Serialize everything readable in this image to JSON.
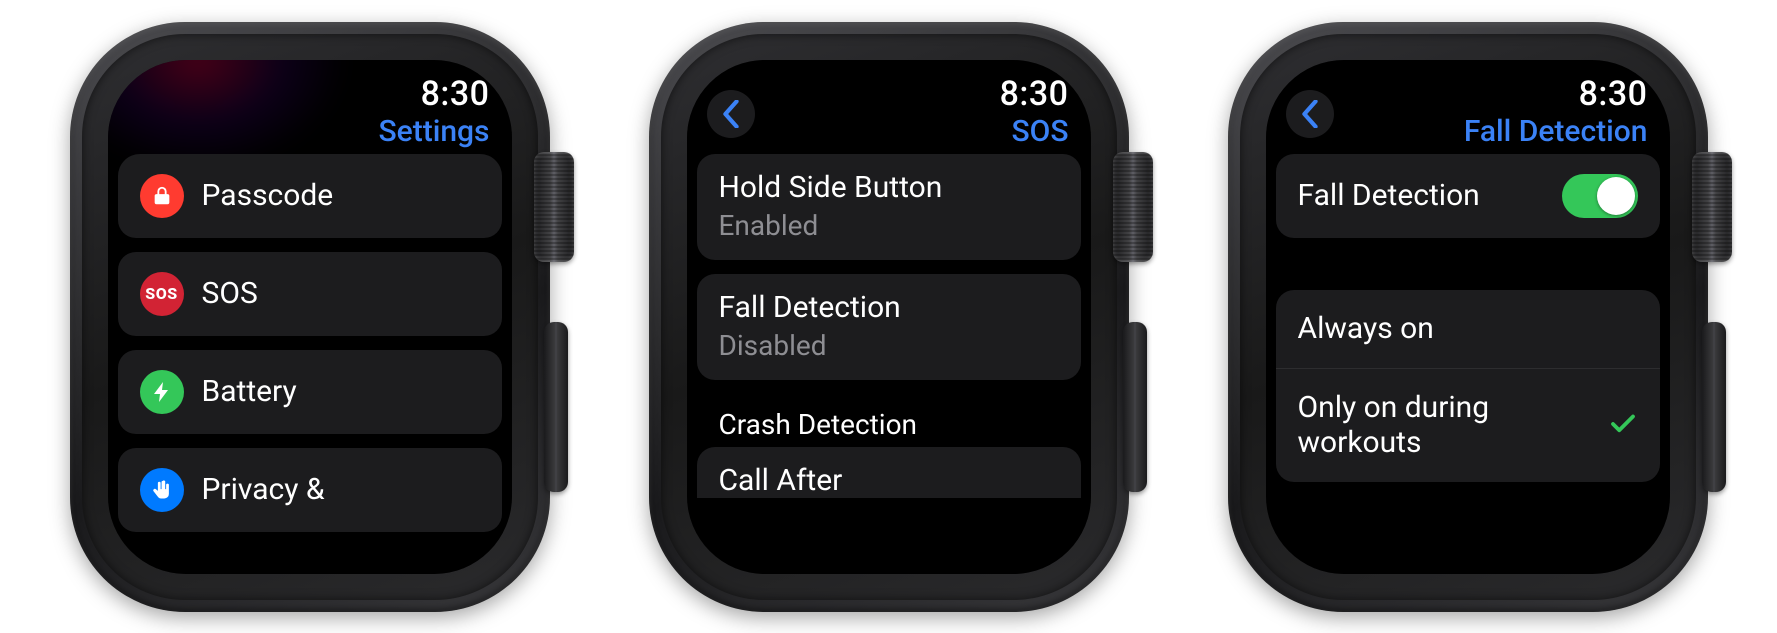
{
  "time": "8:30",
  "accent_blue": "#3b82f6",
  "watch1": {
    "title": "Settings",
    "items": [
      {
        "label": "Passcode",
        "icon": "lock-icon",
        "icon_color": "#ff3b30"
      },
      {
        "label": "SOS",
        "icon": "sos-icon",
        "icon_color": "#d22334"
      },
      {
        "label": "Battery",
        "icon": "bolt-icon",
        "icon_color": "#34c759"
      },
      {
        "label": "Privacy &",
        "icon": "hand-icon",
        "icon_color": "#007aff"
      }
    ]
  },
  "watch2": {
    "title": "SOS",
    "rows": [
      {
        "primary": "Hold Side Button",
        "secondary": "Enabled"
      },
      {
        "primary": "Fall Detection",
        "secondary": "Disabled"
      }
    ],
    "section_header": "Crash Detection",
    "rows2": [
      {
        "primary": "Call After"
      }
    ]
  },
  "watch3": {
    "title": "Fall Detection",
    "toggle": {
      "label": "Fall Detection",
      "on": true
    },
    "options": [
      {
        "label": "Always on",
        "selected": false
      },
      {
        "label": "Only on during workouts",
        "selected": true
      }
    ]
  }
}
